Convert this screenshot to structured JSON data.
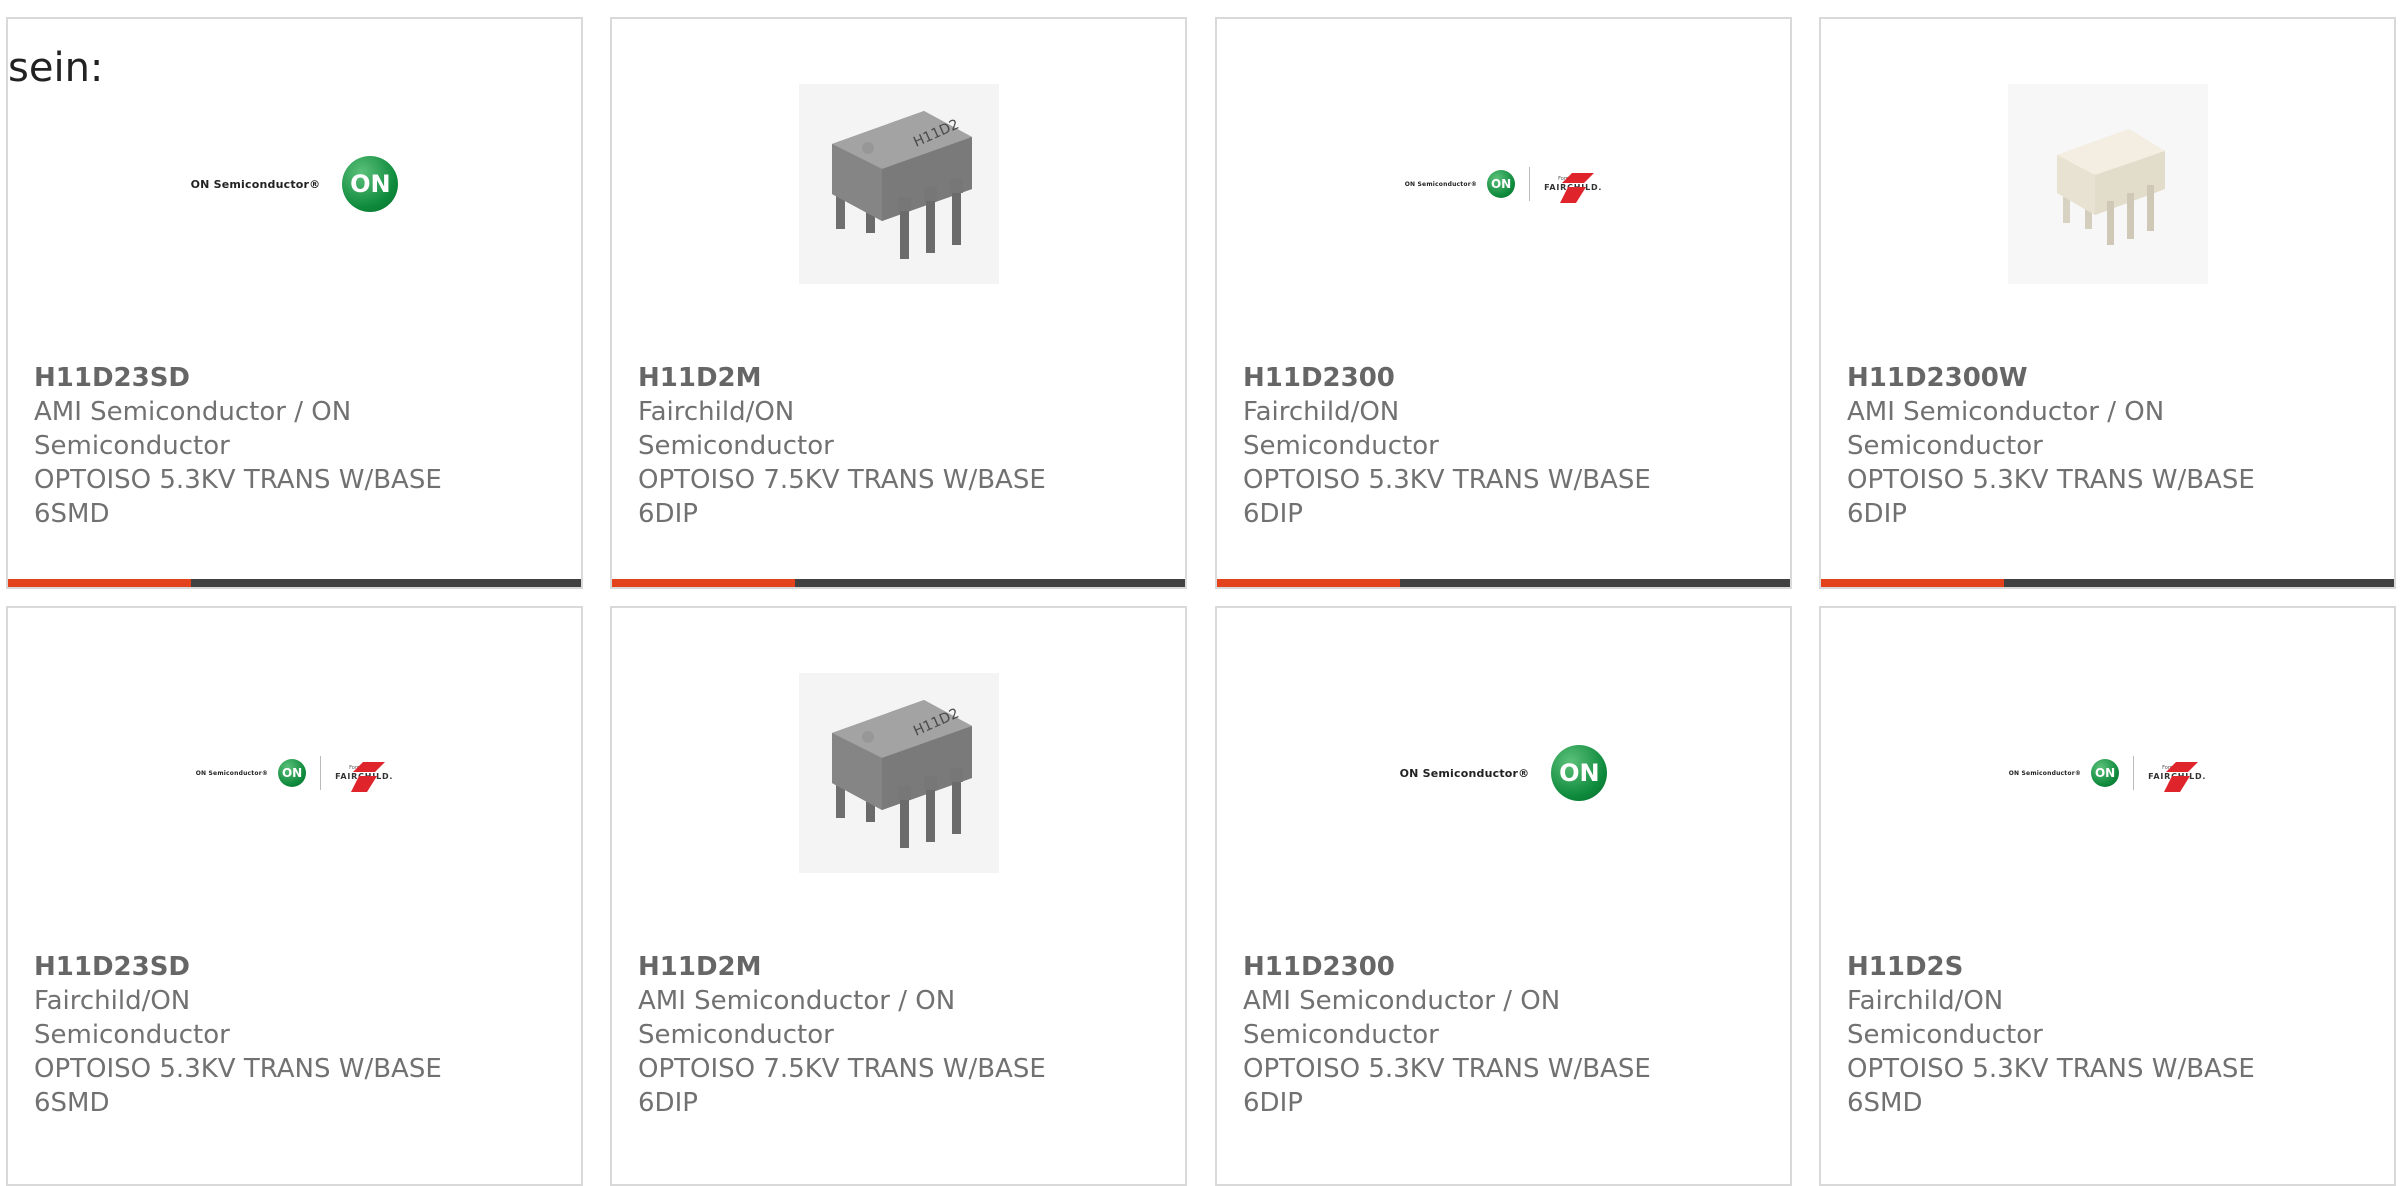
{
  "intro_text": "sein:",
  "colors": {
    "accent": "#e2431c",
    "bar": "#414141",
    "card_border": "#d9d9d9",
    "on_green": "#0e8a3c",
    "fairchild_red": "#e0242b"
  },
  "cards": [
    {
      "part_number": "H11D23SD",
      "manufacturer": "AMI Semiconductor / ON Semiconductor",
      "description": "OPTOISO 5.3KV TRANS W/BASE",
      "package": "6SMD",
      "image": "on-semiconductor-logo"
    },
    {
      "part_number": "H11D2M",
      "manufacturer": "Fairchild/ON Semiconductor",
      "description": "OPTOISO 7.5KV TRANS W/BASE",
      "package": "6DIP",
      "image": "grey-dip6-chip",
      "chip_marking": "H11D2"
    },
    {
      "part_number": "H11D2300",
      "manufacturer": "Fairchild/ON Semiconductor",
      "description": "OPTOISO 5.3KV TRANS W/BASE",
      "package": "6DIP",
      "image": "on-fairchild-logo"
    },
    {
      "part_number": "H11D2300W",
      "manufacturer": "AMI Semiconductor / ON Semiconductor",
      "description": "OPTOISO 5.3KV TRANS W/BASE",
      "package": "6DIP",
      "image": "white-dip6-chip"
    },
    {
      "part_number": "H11D23SD",
      "manufacturer": "Fairchild/ON Semiconductor",
      "description": "OPTOISO 5.3KV TRANS W/BASE",
      "package": "6SMD",
      "image": "on-fairchild-logo"
    },
    {
      "part_number": "H11D2M",
      "manufacturer": "AMI Semiconductor / ON Semiconductor",
      "description": "OPTOISO 7.5KV TRANS W/BASE",
      "package": "6DIP",
      "image": "grey-dip6-chip",
      "chip_marking": "H11D2"
    },
    {
      "part_number": "H11D2300",
      "manufacturer": "AMI Semiconductor / ON Semiconductor",
      "description": "OPTOISO 5.3KV TRANS W/BASE",
      "package": "6DIP",
      "image": "on-semiconductor-logo"
    },
    {
      "part_number": "H11D2S",
      "manufacturer": "Fairchild/ON Semiconductor",
      "description": "OPTOISO 5.3KV TRANS W/BASE",
      "package": "6SMD",
      "image": "on-fairchild-logo"
    }
  ],
  "logos": {
    "on_text": "ON Semiconductor®",
    "on_mark": "ON",
    "fairchild_formerly": "Formerly",
    "fairchild_name": "FAIRCHILD."
  }
}
